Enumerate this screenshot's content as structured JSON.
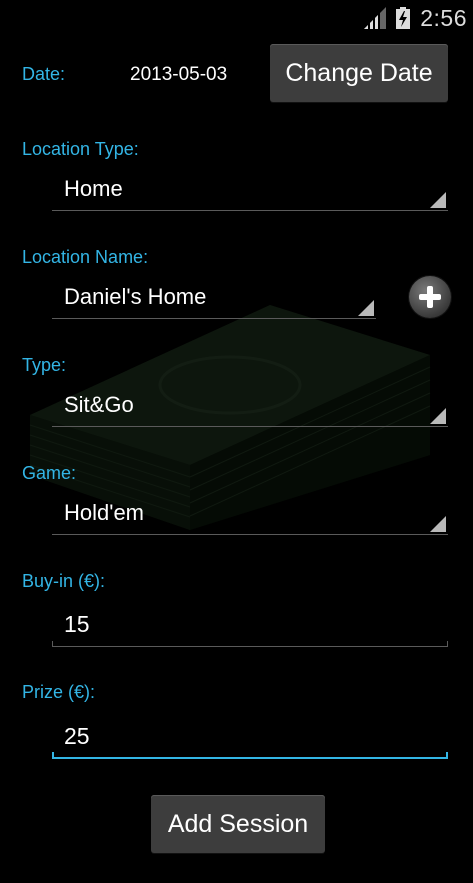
{
  "statusbar": {
    "time": "2:56",
    "signal_icon": "signal-icon",
    "battery_icon": "battery-charging-icon"
  },
  "form": {
    "date": {
      "label": "Date:",
      "value": "2013-05-03",
      "button": "Change Date"
    },
    "location_type": {
      "label": "Location Type:",
      "selected": "Home"
    },
    "location_name": {
      "label": "Location Name:",
      "selected": "Daniel's Home",
      "add_icon": "plus-icon"
    },
    "type": {
      "label": "Type:",
      "selected": "Sit&Go"
    },
    "game": {
      "label": "Game:",
      "selected": "Hold'em"
    },
    "buy_in": {
      "label": "Buy-in (€):",
      "value": "15"
    },
    "prize": {
      "label": "Prize (€):",
      "value": "25"
    },
    "submit": "Add Session"
  },
  "colors": {
    "accent": "#33b5e5",
    "button": "#3d3d3d",
    "background": "#000000"
  }
}
